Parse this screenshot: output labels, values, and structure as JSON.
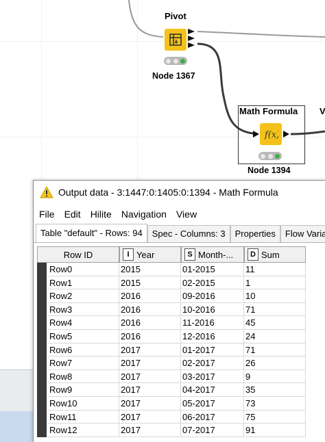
{
  "workflow": {
    "nodes": [
      {
        "title": "Pivot",
        "label": "Node 1367",
        "icon": "pivot-icon"
      },
      {
        "title": "Math Formula",
        "label": "Node 1394",
        "icon": "math-formula-icon"
      }
    ],
    "partial_title": "V"
  },
  "window": {
    "title": "Output data - 3:1447:0:1405:0:1394 - Math Formula",
    "menu": [
      "File",
      "Edit",
      "Hilite",
      "Navigation",
      "View"
    ],
    "tabs": [
      "Table \"default\" - Rows: 94",
      "Spec - Columns: 3",
      "Properties",
      "Flow Varia"
    ]
  },
  "table": {
    "columns": [
      {
        "name": "Row ID",
        "type": ""
      },
      {
        "name": "Year",
        "type": "I"
      },
      {
        "name": "Month-...",
        "type": "S"
      },
      {
        "name": "Sum",
        "type": "D"
      }
    ],
    "rows": [
      [
        "Row0",
        "2015",
        "01-2015",
        "11"
      ],
      [
        "Row1",
        "2015",
        "02-2015",
        "1"
      ],
      [
        "Row2",
        "2016",
        "09-2016",
        "10"
      ],
      [
        "Row3",
        "2016",
        "10-2016",
        "71"
      ],
      [
        "Row4",
        "2016",
        "11-2016",
        "45"
      ],
      [
        "Row5",
        "2016",
        "12-2016",
        "24"
      ],
      [
        "Row6",
        "2017",
        "01-2017",
        "71"
      ],
      [
        "Row7",
        "2017",
        "02-2017",
        "26"
      ],
      [
        "Row8",
        "2017",
        "03-2017",
        "9"
      ],
      [
        "Row9",
        "2017",
        "04-2017",
        "35"
      ],
      [
        "Row10",
        "2017",
        "05-2017",
        "73"
      ],
      [
        "Row11",
        "2017",
        "06-2017",
        "75"
      ],
      [
        "Row12",
        "2017",
        "07-2017",
        "91"
      ]
    ]
  },
  "colors": {
    "node_yellow": "#f4c21a",
    "status_green": "#3cb043",
    "warning_yellow": "#f5c518"
  }
}
